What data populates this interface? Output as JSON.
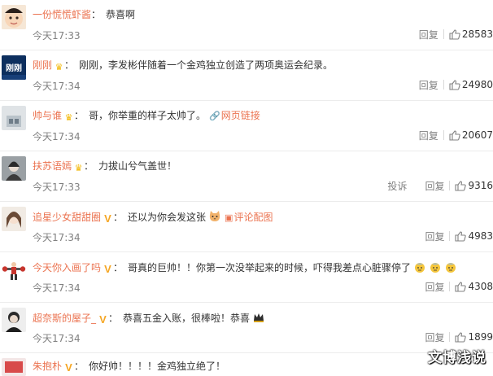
{
  "time": "今天17:33",
  "comments": [
    {
      "user": "一份慌慌虾酱",
      "badge": "",
      "text": "恭喜啊",
      "time": "今天17:33",
      "report": "",
      "reply": "回复",
      "likes": "28583"
    },
    {
      "user": "刚刚",
      "badge": "crown",
      "avatar_text": "刚刚",
      "text": "刚刚，李发彬伴随着一个金鸡独立创造了两项奥运会纪录。",
      "time": "今天17:34",
      "report": "",
      "reply": "回复",
      "likes": "24980"
    },
    {
      "user": "帅与谁",
      "badge": "crown",
      "text": "哥，你举重的样子太帅了。",
      "link": "网页链接",
      "time": "今天17:34",
      "report": "",
      "reply": "回复",
      "likes": "20607"
    },
    {
      "user": "扶苏语嫣",
      "badge": "crown",
      "text": "力拔山兮气盖世！",
      "time": "今天17:33",
      "report": "投诉",
      "reply": "回复",
      "likes": "9316"
    },
    {
      "user": "追星少女甜甜圈",
      "badge": "v",
      "text": "还以为你会发这张",
      "link": "评论配图",
      "emoji": "cat",
      "time": "今天17:34",
      "report": "",
      "reply": "回复",
      "likes": "4983"
    },
    {
      "user": "今天你入画了吗",
      "badge": "v",
      "text": "哥真的巨帅！！你第一次没举起来的时候，吓得我差点心脏骤停了",
      "emoji": "sweat3",
      "time": "今天17:34",
      "report": "",
      "reply": "回复",
      "likes": "4308"
    },
    {
      "user": "超奈斯的屋子_",
      "badge": "v",
      "text": "恭喜五金入账，很棒啦！恭喜",
      "emoji": "crown-dark",
      "time": "今天17:34",
      "report": "",
      "reply": "回复",
      "likes": "1899"
    },
    {
      "user": "朱抱朴",
      "badge": "v",
      "text": "你好帅！！！！金鸡独立绝了！",
      "time": "",
      "report": "",
      "reply": "",
      "likes": ""
    }
  ],
  "watermark": "文博浅说",
  "icons": {
    "like": "thumbs-up-icon",
    "crown": "crown-icon",
    "verified": "verified-v-icon",
    "link": "link-icon"
  },
  "colors": {
    "username": "#eb7350",
    "meta": "#808080",
    "badge_gold": "#f2b600"
  }
}
